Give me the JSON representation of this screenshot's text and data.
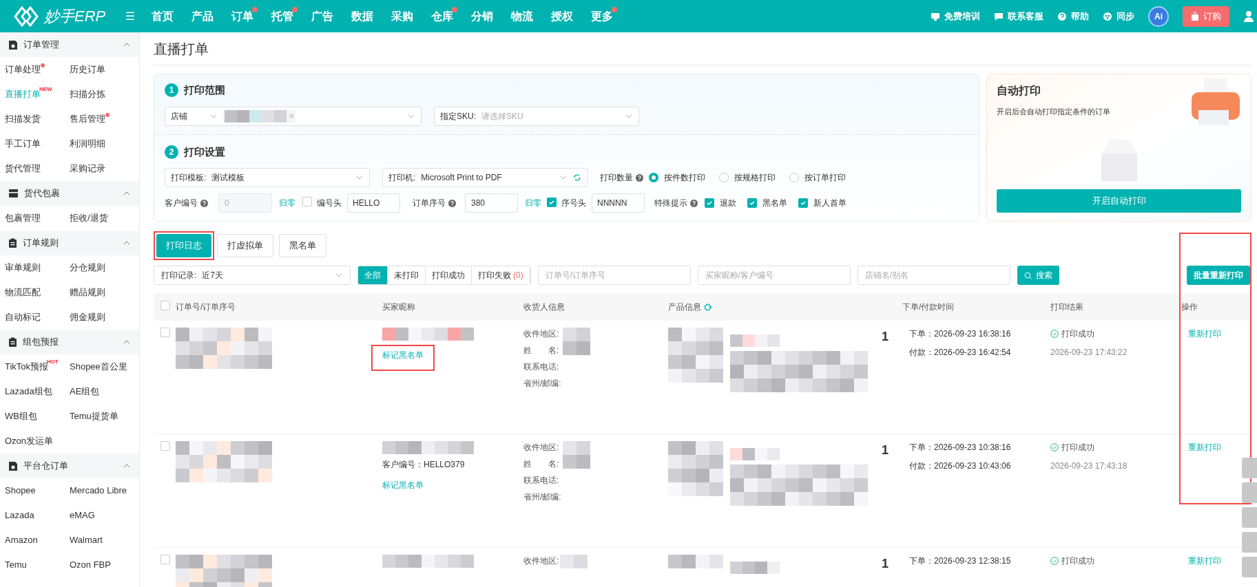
{
  "topbar": {
    "logo": "妙手ERP",
    "menu_icon": "☰",
    "nav": [
      {
        "label": "首页",
        "dot": false
      },
      {
        "label": "产品",
        "dot": false
      },
      {
        "label": "订单",
        "dot": true
      },
      {
        "label": "托管",
        "dot": true
      },
      {
        "label": "广告",
        "dot": false
      },
      {
        "label": "数据",
        "dot": false
      },
      {
        "label": "采购",
        "dot": false
      },
      {
        "label": "仓库",
        "dot": true
      },
      {
        "label": "分销",
        "dot": false
      },
      {
        "label": "物流",
        "dot": false
      },
      {
        "label": "授权",
        "dot": false
      },
      {
        "label": "更多",
        "dot": true
      }
    ],
    "links": [
      {
        "kind": "training",
        "label": "免费培训"
      },
      {
        "kind": "service",
        "label": "联系客服"
      },
      {
        "kind": "help",
        "label": "帮助"
      },
      {
        "kind": "sync",
        "label": "同步"
      }
    ],
    "ai": "Ai",
    "buy": "订购"
  },
  "sidebar": [
    {
      "kind": "orders",
      "title": "订单管理",
      "expanded": true,
      "items": [
        {
          "label": "订单处理",
          "dot": true,
          "selected": false
        },
        {
          "label": "历史订单",
          "dot": false,
          "selected": false
        },
        {
          "label": "直播打单",
          "badge": "NEW",
          "dot": false,
          "selected": true
        },
        {
          "label": "扫描分拣",
          "dot": false,
          "selected": false
        },
        {
          "label": "扫描发货",
          "dot": false,
          "selected": false
        },
        {
          "label": "售后管理",
          "dot": true,
          "selected": false
        },
        {
          "label": "手工订单",
          "dot": false,
          "selected": false
        },
        {
          "label": "利润明细",
          "dot": false,
          "selected": false
        },
        {
          "label": "货代管理",
          "dot": false,
          "selected": false
        },
        {
          "label": "采购记录",
          "dot": false,
          "selected": false
        }
      ]
    },
    {
      "kind": "package",
      "title": "货代包裹",
      "expanded": true,
      "items": [
        {
          "label": "包裹管理",
          "dot": false,
          "selected": false
        },
        {
          "label": "拒收/退货",
          "dot": false,
          "selected": false
        }
      ]
    },
    {
      "kind": "rules",
      "title": "订单规则",
      "expanded": true,
      "items": [
        {
          "label": "审单规则",
          "dot": false,
          "selected": false
        },
        {
          "label": "分仓规则",
          "dot": false,
          "selected": false
        },
        {
          "label": "物流匹配",
          "dot": false,
          "selected": false
        },
        {
          "label": "赠品规则",
          "dot": false,
          "selected": false
        },
        {
          "label": "自动标记",
          "dot": false,
          "selected": false
        },
        {
          "label": "佣金规则",
          "dot": false,
          "selected": false
        }
      ]
    },
    {
      "kind": "rules",
      "title": "组包预报",
      "expanded": true,
      "items": [
        {
          "label": "TikTok预报",
          "badge": "HOT",
          "dot": false,
          "selected": false
        },
        {
          "label": "Shopee首公里",
          "dot": false,
          "selected": false
        },
        {
          "label": "Lazada组包",
          "dot": false,
          "selected": false
        },
        {
          "label": "AE组包",
          "dot": false,
          "selected": false
        },
        {
          "label": "WB组包",
          "dot": false,
          "selected": false
        },
        {
          "label": "Temu提货单",
          "dot": false,
          "selected": false
        },
        {
          "label": "Ozon发运单",
          "dot": false,
          "selected": false
        }
      ]
    },
    {
      "kind": "orders",
      "title": "平台仓订单",
      "expanded": true,
      "items": [
        {
          "label": "Shopee",
          "dot": false,
          "selected": false
        },
        {
          "label": "Mercado Libre",
          "dot": false,
          "selected": false
        },
        {
          "label": "Lazada",
          "dot": false,
          "selected": false
        },
        {
          "label": "eMAG",
          "dot": false,
          "selected": false
        },
        {
          "label": "Amazon",
          "dot": false,
          "selected": false
        },
        {
          "label": "Walmart",
          "dot": false,
          "selected": false
        },
        {
          "label": "Temu",
          "dot": false,
          "selected": false
        },
        {
          "label": "Ozon FBP",
          "dot": false,
          "selected": false
        }
      ]
    }
  ],
  "page_title": "直播打单",
  "print_scope": {
    "step": "1",
    "title": "打印范围",
    "shop_label": "店铺",
    "sku_label": "指定SKU:",
    "sku_placeholder": "请选择SKU"
  },
  "print_settings": {
    "step": "2",
    "title": "打印设置",
    "template_label": "打印模板:",
    "template_value": "测试模板",
    "printer_label": "打印机:",
    "printer_value": "Microsoft Print to PDF",
    "quantity_label": "打印数量",
    "quantity_options": [
      {
        "label": "按件数打印",
        "selected": true
      },
      {
        "label": "按规格打印",
        "selected": false
      },
      {
        "label": "按订单打印",
        "selected": false
      }
    ],
    "customer_no_label": "客户编号",
    "customer_no_value": "0",
    "reset_1": "归零",
    "prefix_1": {
      "label": "编号头",
      "checked": false
    },
    "prefix_1_value": "HELLO",
    "order_seq_label": "订单序号",
    "order_seq_value": "380",
    "reset_2": "归零",
    "prefix_2": {
      "label": "序号头",
      "checked": true
    },
    "prefix_2_value": "NNNNN",
    "tips_label": "特殊提示",
    "tips": [
      {
        "label": "退款",
        "checked": true
      },
      {
        "label": "黑名单",
        "checked": true
      },
      {
        "label": "新人首单",
        "checked": true
      }
    ]
  },
  "auto_print": {
    "title": "自动打印",
    "description": "开启后会自动打印指定条件的订单",
    "button": "开启自动打印"
  },
  "tabs": [
    {
      "label": "打印日志",
      "selected": true,
      "highlighted": true
    },
    {
      "label": "打虚拟单",
      "selected": false,
      "highlighted": false
    },
    {
      "label": "黑名单",
      "selected": false,
      "highlighted": false
    }
  ],
  "filters": {
    "record_label": "打印记录:",
    "record_value": "近7天",
    "status": [
      {
        "label": "全部",
        "selected": true
      },
      {
        "label": "未打印",
        "selected": false
      },
      {
        "label": "打印成功",
        "selected": false
      },
      {
        "label": "打印失败",
        "count": "(0)",
        "selected": false
      }
    ],
    "order_placeholder": "订单号/订单序号",
    "buyer_placeholder": "买家昵称/客户编号",
    "shop_placeholder": "店铺名/别名",
    "search": "搜索",
    "batch": "批量重新打印"
  },
  "table": {
    "select_all_checked": false,
    "action_column_highlighted": true,
    "columns": [
      "订单号/订单序号",
      "买家昵称",
      "收货人信息",
      "产品信息",
      "下单/付款时间",
      "打印结果",
      "操作"
    ],
    "rows": [
      {
        "checked": false,
        "receiver_labels": [
          "收件地区:",
          "姓　　名:",
          "联系电话:",
          "省州/邮编:"
        ],
        "blacklist": "标记黑名单",
        "highlighted": true,
        "quantity": "1",
        "ordered": "下单：2026-09-23 16:38:16",
        "paid": "付款：2026-09-23 16:42:54",
        "result": "打印成功",
        "printed": "2026-09-23 17:43:22",
        "action": "重新打印"
      },
      {
        "checked": false,
        "receiver_labels": [
          "收件地区:",
          "姓　　名:",
          "联系电话:",
          "省州/邮编:"
        ],
        "customer_no": "客户编号：HELLO379",
        "blacklist": "标记黑名单",
        "highlighted": false,
        "quantity": "1",
        "ordered": "下单：2026-09-23 10:38:16",
        "paid": "付款：2026-09-23 10:43:06",
        "result": "打印成功",
        "printed": "2026-09-23 17:43:18",
        "action": "重新打印"
      },
      {
        "checked": false,
        "receiver_labels": [
          "收件地区:"
        ],
        "quantity": "1",
        "ordered": "下单：2026-09-23 12:38:15",
        "result": "打印成功",
        "action": "重新打印"
      }
    ]
  }
}
